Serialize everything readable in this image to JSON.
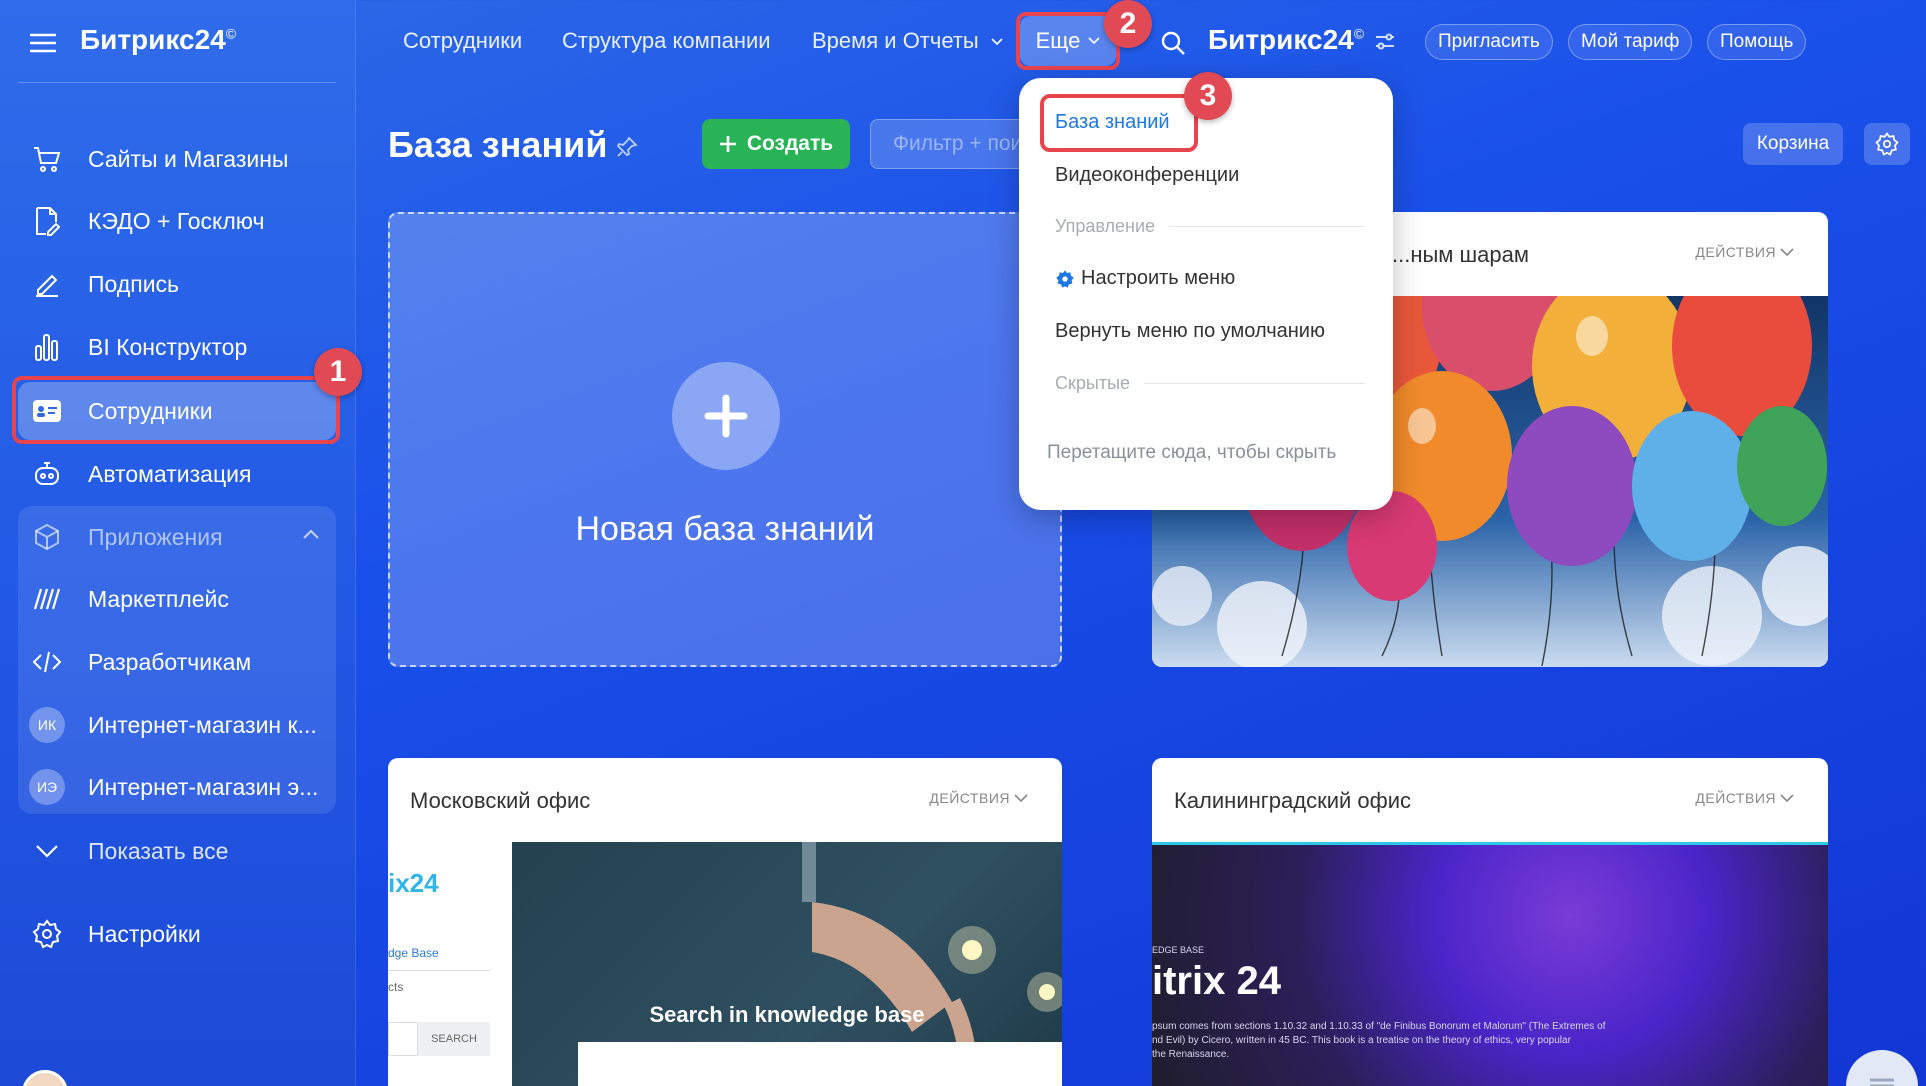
{
  "sidebar": {
    "logo": "Битрикс24",
    "logo_mark": "©",
    "items": [
      {
        "label": "Сайты и Магазины",
        "icon": "cart-icon"
      },
      {
        "label": "КЭДО + Госключ",
        "icon": "document-signature-icon"
      },
      {
        "label": "Подпись",
        "icon": "pen-icon"
      },
      {
        "label": "BI Конструктор",
        "icon": "bar-chart-icon"
      },
      {
        "label": "Сотрудники",
        "icon": "employee-card-icon",
        "active": true
      },
      {
        "label": "Автоматизация",
        "icon": "robot-icon"
      }
    ],
    "apps": {
      "label": "Приложения",
      "items": [
        {
          "label": "Маркетплейс",
          "icon": "marketplace-icon"
        },
        {
          "label": "Разработчикам",
          "icon": "code-icon"
        },
        {
          "label": "Интернет-магазин к...",
          "avatar": "ИК"
        },
        {
          "label": "Интернет-магазин э...",
          "avatar": "ИЭ"
        }
      ]
    },
    "show_all": "Показать все",
    "settings": "Настройки"
  },
  "topbar": {
    "nav": [
      "Сотрудники",
      "Структура компании",
      "Время и Отчеты"
    ],
    "more": "Еще",
    "brand": "Битрикс24",
    "brand_mark": "©",
    "invite": "Пригласить",
    "tariff": "Мой тариф",
    "help": "Помощь"
  },
  "page": {
    "title": "База знаний",
    "create": "Создать",
    "filter_placeholder": "Фильтр + поиск",
    "trash": "Корзина",
    "new_kb": "Новая база знаний"
  },
  "cards": [
    {
      "title": "...ным шарам",
      "actions": "ДЕЙСТВИЯ"
    },
    {
      "title": "Московский офис",
      "actions": "ДЕЙСТВИЯ",
      "preview": {
        "logo": "ix24",
        "nav1": "dge Base",
        "nav2": "cts",
        "search_btn": "SEARCH",
        "headline": "Search in knowledge base"
      }
    },
    {
      "title": "Калининградский офис",
      "actions": "ДЕЙСТВИЯ",
      "preview": {
        "kicker": "EDGE BASE",
        "headline": "itrix 24",
        "text1": "psum comes from sections 1.10.32 and 1.10.33 of \"de Finibus Bonorum et Malorum\" (The Extremes of",
        "text2": "nd Evil) by Cicero, written in 45 BC. This book is a treatise on the theory of ethics, very popular",
        "text3": "the Renaissance."
      }
    }
  ],
  "menu": {
    "items": [
      "База знаний",
      "Видеоконференции"
    ],
    "section_manage": "Управление",
    "configure": "Настроить меню",
    "reset": "Вернуть меню по умолчанию",
    "section_hidden": "Скрытые",
    "hint": "Перетащите сюда, чтобы скрыть"
  },
  "callouts": [
    "1",
    "2",
    "3"
  ],
  "colors": {
    "accent_red": "#e14a55",
    "create_green": "#27b356",
    "menu_link": "#1e78e6"
  }
}
